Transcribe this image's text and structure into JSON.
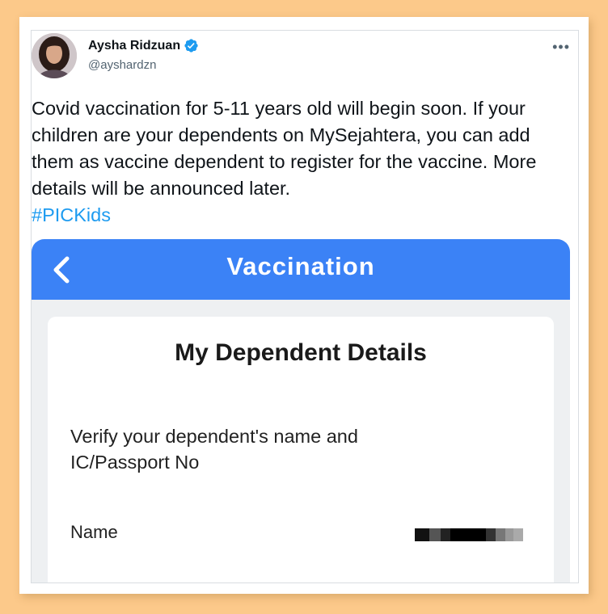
{
  "tweet": {
    "author": {
      "display_name": "Aysha Ridzuan",
      "handle": "@ayshardzn",
      "verified": true
    },
    "more_icon": "more-horizontal-icon",
    "text": "Covid vaccination for 5-11 years old will begin soon. If your children are your dependents on MySejahtera, you can add them as vaccine dependent to register for the vaccine. More details will be announced later.",
    "hashtag": "#PICKids",
    "link_color": "#1d9bf0"
  },
  "media": {
    "app_header": {
      "title": "Vaccination",
      "back_icon": "chevron-left-icon",
      "color": "#3b82f6"
    },
    "card": {
      "title": "My Dependent Details",
      "instruction": "Verify your dependent's name and IC/Passport No",
      "name_label": "Name"
    }
  },
  "colors": {
    "background": "#fcc98a",
    "header_blue": "#3b82f6"
  }
}
